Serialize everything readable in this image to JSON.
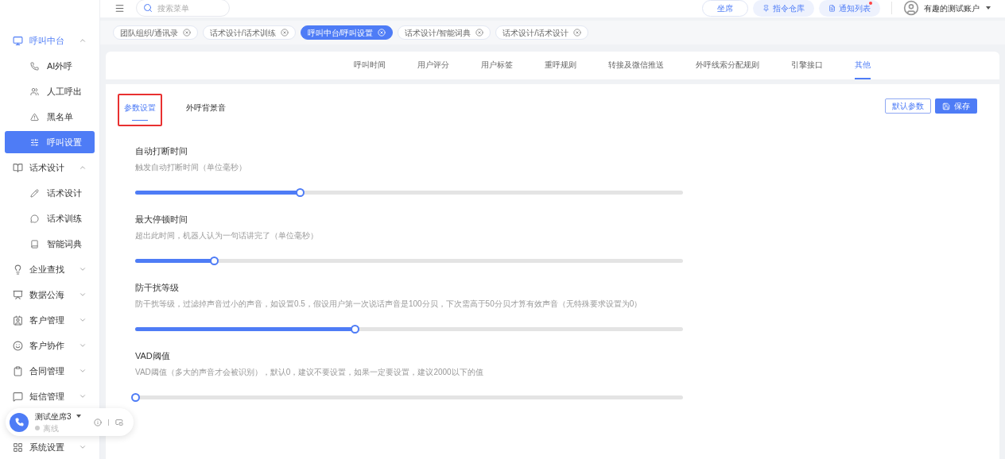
{
  "sidebar": {
    "items": [
      {
        "label": "呼叫中台",
        "expanded": true,
        "selected": false,
        "children": [
          {
            "label": "AI外呼",
            "selected": false
          },
          {
            "label": "人工呼出",
            "selected": false
          },
          {
            "label": "黑名单",
            "selected": false
          },
          {
            "label": "呼叫设置",
            "selected": true
          }
        ]
      },
      {
        "label": "话术设计",
        "expanded": true,
        "selected": false,
        "children": [
          {
            "label": "话术设计",
            "selected": false
          },
          {
            "label": "话术训练",
            "selected": false
          },
          {
            "label": "智能词典",
            "selected": false
          }
        ]
      },
      {
        "label": "企业查找",
        "expanded": false,
        "selected": false
      },
      {
        "label": "数据公海",
        "expanded": false,
        "selected": false
      },
      {
        "label": "客户管理",
        "expanded": false,
        "selected": false
      },
      {
        "label": "客户协作",
        "expanded": false,
        "selected": false
      },
      {
        "label": "合同管理",
        "expanded": false,
        "selected": false
      },
      {
        "label": "短信管理",
        "expanded": false,
        "selected": false
      },
      {
        "label": "系统设置",
        "expanded": false,
        "selected": false
      }
    ]
  },
  "header": {
    "search": {
      "placeholder": "搜索菜单"
    },
    "buttons": [
      {
        "label": "坐席",
        "kind": "outline",
        "badge": false
      },
      {
        "label": "指令仓库",
        "kind": "soft",
        "badge": false
      },
      {
        "label": "通知列表",
        "kind": "soft",
        "badge": true
      }
    ],
    "account": "有趣的测试账户"
  },
  "tags": [
    {
      "label": "团队组织/通讯录",
      "selected": false
    },
    {
      "label": "话术设计/话术训练",
      "selected": false
    },
    {
      "label": "呼叫中台/呼叫设置",
      "selected": true
    },
    {
      "label": "话术设计/智能词典",
      "selected": false
    },
    {
      "label": "话术设计/话术设计",
      "selected": false
    }
  ],
  "tabs": [
    {
      "label": "呼叫时间",
      "selected": false
    },
    {
      "label": "用户评分",
      "selected": false
    },
    {
      "label": "用户标签",
      "selected": false
    },
    {
      "label": "重呼规则",
      "selected": false
    },
    {
      "label": "转接及微信推送",
      "selected": false
    },
    {
      "label": "外呼线索分配规则",
      "selected": false
    },
    {
      "label": "引擎接口",
      "selected": false
    },
    {
      "label": "其他",
      "selected": true
    }
  ],
  "sub_tabs": [
    {
      "label": "参数设置",
      "selected": true,
      "highlighted": true
    },
    {
      "label": "外呼背景音",
      "selected": false,
      "highlighted": false
    }
  ],
  "actions": [
    {
      "label": "默认参数",
      "kind": "outline"
    },
    {
      "label": "保存",
      "kind": "primary"
    }
  ],
  "settings": [
    {
      "title": "自动打断时间",
      "description": "触发自动打断时间（单位毫秒）",
      "level": 0.3
    },
    {
      "title": "最大停顿时间",
      "description": "超出此时间，机器人认为一句话讲完了（单位毫秒）",
      "level": 0.144
    },
    {
      "title": "防干扰等级",
      "description": "防干扰等级，过滤掉声音过小的声音，如设置0.5，假设用户第一次说话声音是100分贝，下次需高于50分贝才算有效声音（无特殊要求设置为0）",
      "level": 0.4
    },
    {
      "title": "VAD阈值",
      "description": "VAD阈值（多大的声音才会被识别），默认0，建议不要设置，如果一定要设置，建议2000以下的值",
      "level": 0
    }
  ],
  "agent": {
    "name": "测试坐席3",
    "status": "离线",
    "online": false
  }
}
